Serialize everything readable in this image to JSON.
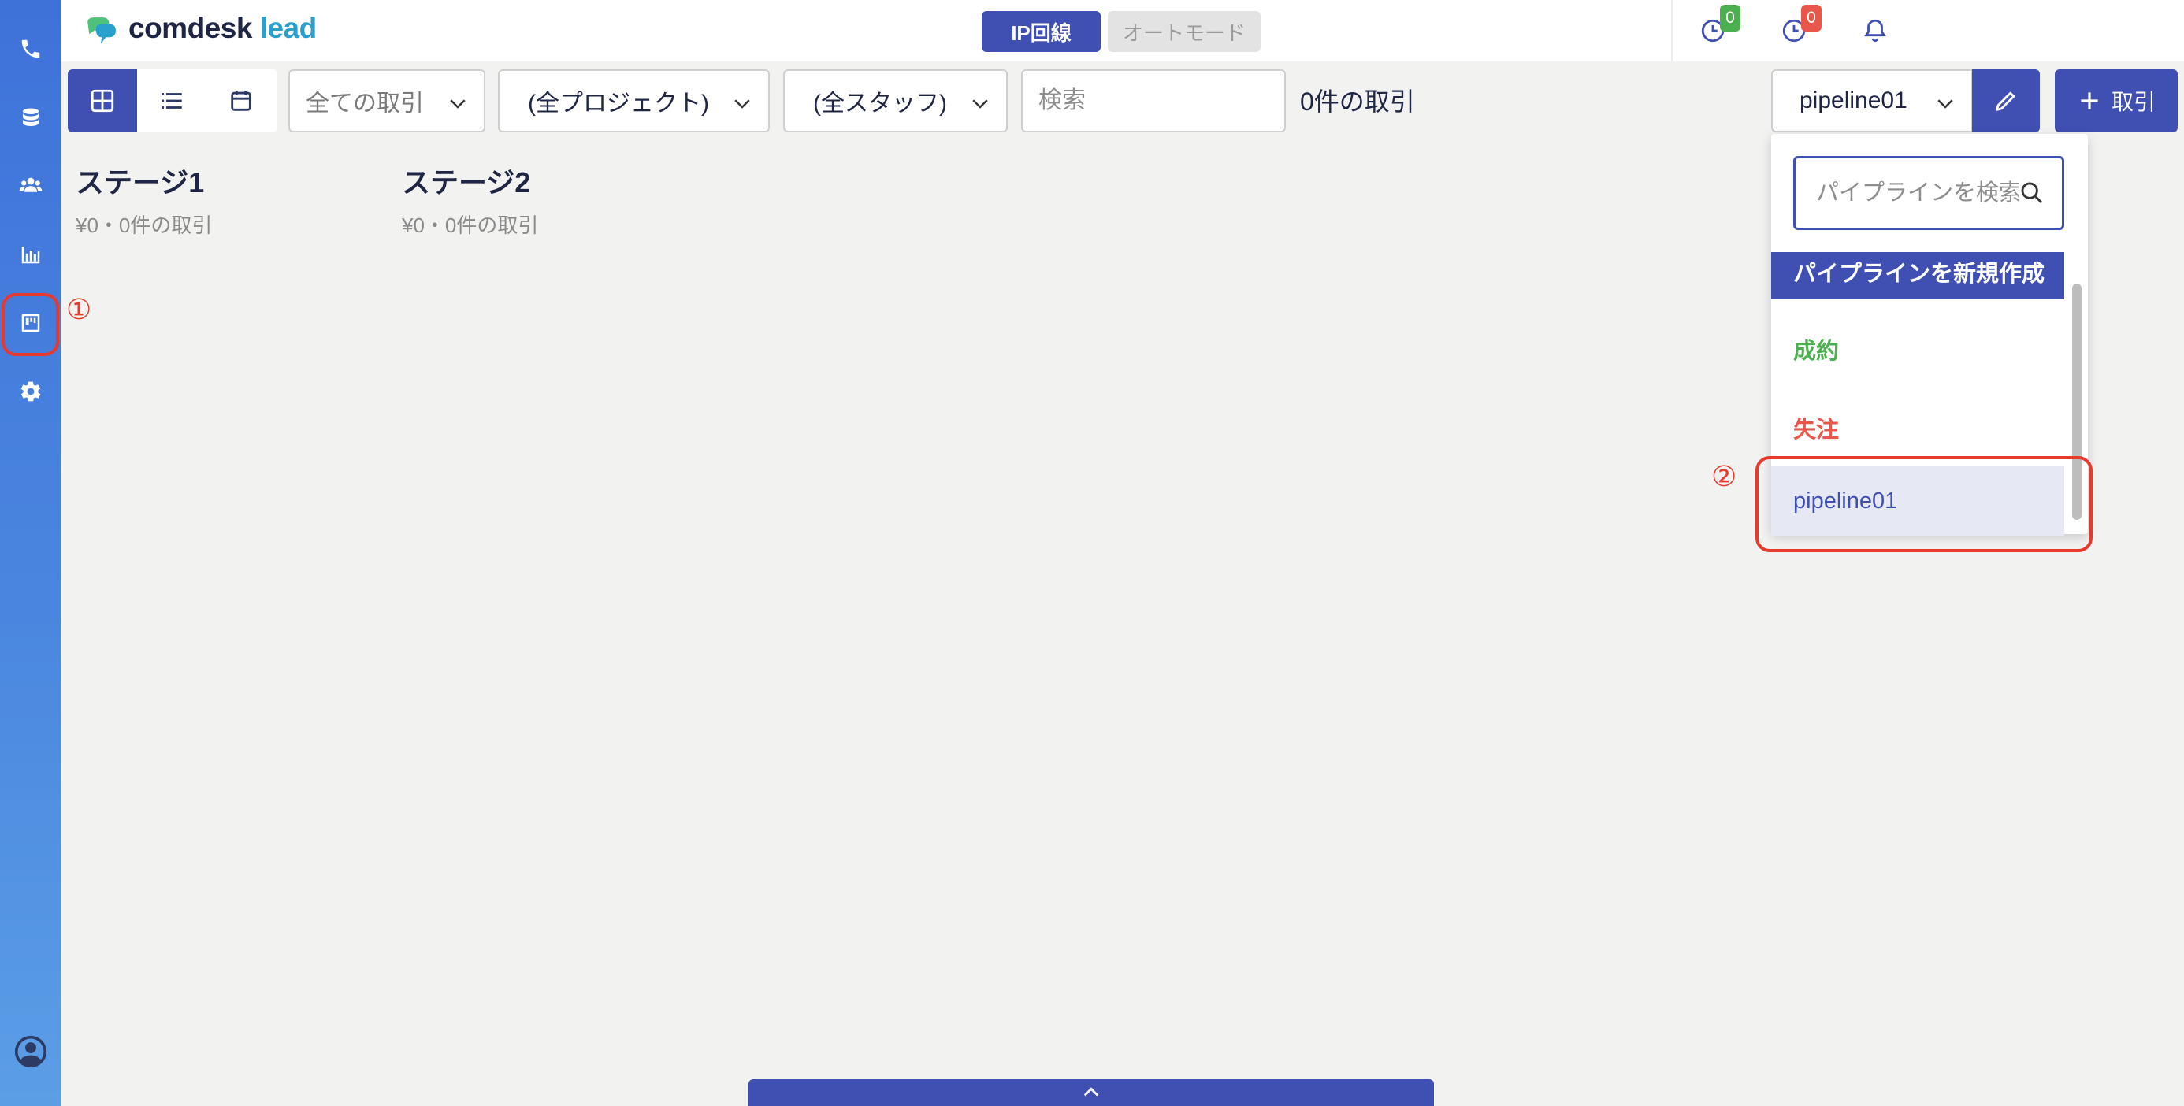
{
  "app": {
    "logo_primary": "comdesk",
    "logo_secondary": "lead"
  },
  "sidebar": {
    "items": [
      {
        "name": "phone-icon"
      },
      {
        "name": "database-icon"
      },
      {
        "name": "users-icon"
      },
      {
        "name": "chart-icon"
      },
      {
        "name": "board-icon"
      },
      {
        "name": "gear-icon"
      },
      {
        "name": "user-circle-icon"
      }
    ]
  },
  "annotations": {
    "marker_1": "①",
    "marker_2": "②",
    "color": "#e8392d"
  },
  "header": {
    "mode_ip_label": "IP回線",
    "mode_auto_label": "オートモード",
    "badge_1": "0",
    "badge_1_color": "#4caf50",
    "badge_2": "0",
    "badge_2_color": "#e8574a"
  },
  "toolbar": {
    "deal_filter": "全ての取引",
    "project_filter": "(全プロジェクト)",
    "staff_filter": "(全スタッフ)",
    "search_placeholder": "検索",
    "deal_count": "0件の取引",
    "pipeline_select": "pipeline01",
    "add_button_label": "取引"
  },
  "stages": [
    {
      "title": "ステージ1",
      "summary": "¥0・0件の取引"
    },
    {
      "title": "ステージ2",
      "summary": "¥0・0件の取引"
    }
  ],
  "pipeline_dropdown": {
    "search_placeholder": "パイプラインを検索",
    "items": [
      {
        "label": "パイプラインを新規作成",
        "color": "#ffffff",
        "bg": "#3f4fb2"
      },
      {
        "label": "成約",
        "color": "#4caf50"
      },
      {
        "label": "失注",
        "color": "#e8574a"
      },
      {
        "label": "pipeline01",
        "color": "#3f4fb2",
        "bg": "#e6e8f4"
      }
    ]
  },
  "colors": {
    "primary": "#3f4fb2",
    "sidebar_top": "#3f72d9",
    "background": "#f2f2f1"
  }
}
